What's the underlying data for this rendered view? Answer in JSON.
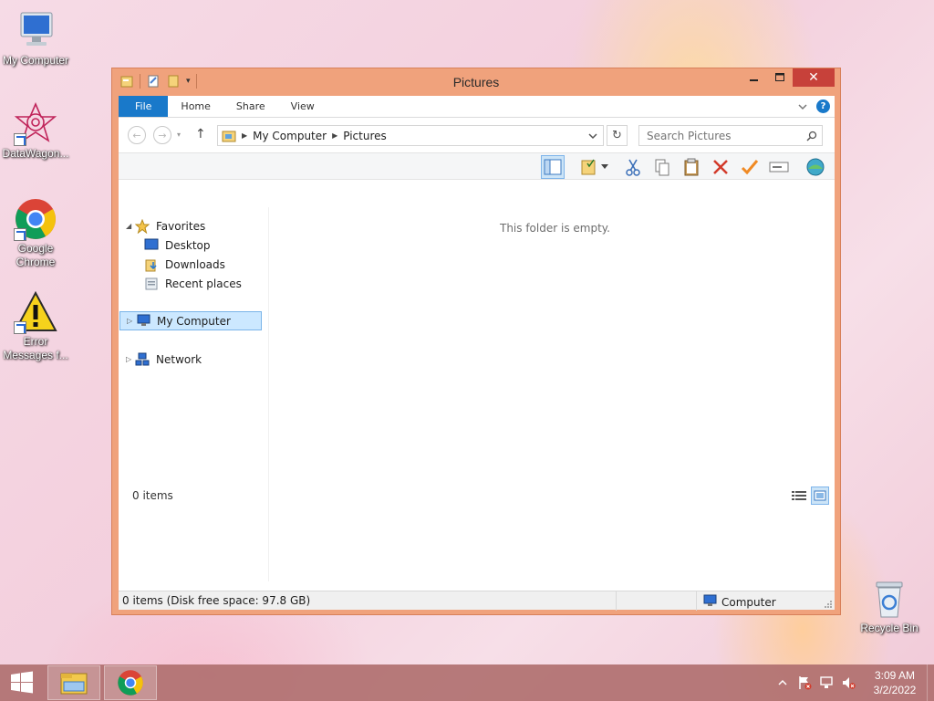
{
  "desktop": {
    "icons": [
      {
        "label": "My Computer"
      },
      {
        "label": "DataWagon..."
      },
      {
        "label": "Google Chrome"
      },
      {
        "label": "Error Messages f..."
      },
      {
        "label": "Recycle Bin"
      }
    ]
  },
  "window": {
    "title": "Pictures",
    "ribbon_tabs": [
      "File",
      "Home",
      "Share",
      "View"
    ],
    "address": {
      "crumbs": [
        "My Computer",
        "Pictures"
      ]
    },
    "search": {
      "placeholder": "Search Pictures"
    },
    "nav": {
      "favorites": "Favorites",
      "desktop": "Desktop",
      "downloads": "Downloads",
      "recent": "Recent places",
      "my_computer": "My Computer",
      "network": "Network"
    },
    "empty_message": "This folder is empty.",
    "items_count": "0 items",
    "status": {
      "left": "0 items (Disk free space: 97.8 GB)",
      "right": "Computer"
    }
  },
  "taskbar": {
    "clock": {
      "time": "3:09 AM",
      "date": "3/2/2022"
    }
  },
  "colors": {
    "accent": "#1979ca",
    "title_bar": "#f0a27c",
    "close": "#c7413a",
    "taskbar": "#b07070"
  }
}
